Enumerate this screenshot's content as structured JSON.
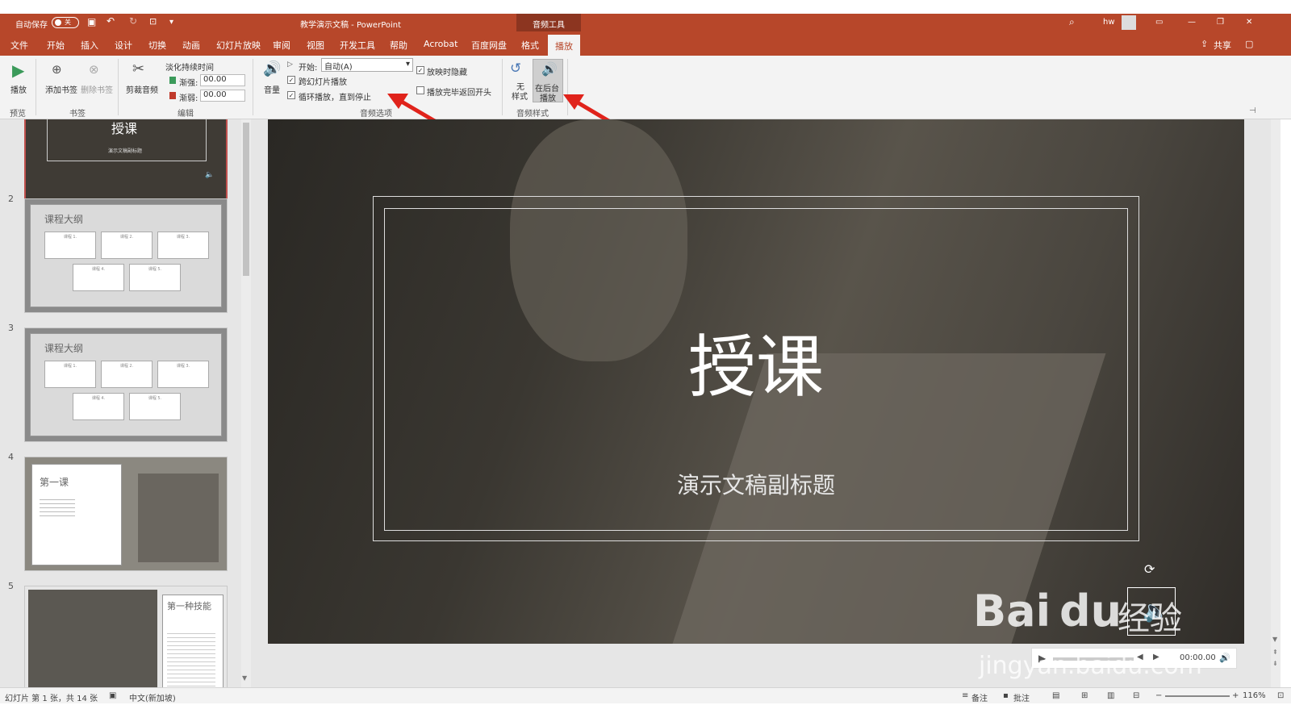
{
  "titlebar": {
    "autosave_label": "自动保存",
    "autosave_state": "关",
    "doc_title": "教学演示文稿 - PowerPoint",
    "context_group": "音频工具",
    "user": "hw"
  },
  "menu": {
    "tabs": [
      "文件",
      "开始",
      "插入",
      "设计",
      "切换",
      "动画",
      "幻灯片放映",
      "审阅",
      "视图",
      "开发工具",
      "帮助",
      "Acrobat",
      "百度网盘",
      "格式"
    ],
    "active_tab": "播放",
    "share": "共享"
  },
  "ribbon": {
    "preview": {
      "play": "播放",
      "group": "预览"
    },
    "bookmarks": {
      "add": "添加书签",
      "remove": "删除书签",
      "group": "书签"
    },
    "editing": {
      "trim": "剪裁音频",
      "fade_title": "淡化持续时间",
      "fade_in_label": "渐强:",
      "fade_in_value": "00.00",
      "fade_out_label": "渐弱:",
      "fade_out_value": "00.00",
      "group": "编辑"
    },
    "audio_options": {
      "volume": "音量",
      "start_label": "开始:",
      "start_value": "自动(A)",
      "across_slides": "跨幻灯片播放",
      "loop": "循环播放，直到停止",
      "hide": "放映时隐藏",
      "rewind": "播放完毕返回开头",
      "group": "音频选项",
      "across_checked": "✓",
      "loop_checked": "✓",
      "hide_checked": "✓"
    },
    "audio_styles": {
      "none_l1": "无",
      "none_l2": "样式",
      "bg_l1": "在后台",
      "bg_l2": "播放",
      "group": "音频样式"
    }
  },
  "slides_pane": {
    "numbers": [
      "2",
      "3",
      "4",
      "5"
    ],
    "thumb1_title": "授课",
    "thumb1_sub": "演示文稿副标题",
    "thumb2_title": "课程大纲",
    "thumb3_title": "课程大纲",
    "cards": [
      "课程 1.",
      "课程 2.",
      "课程 3.",
      "课程 4.",
      "课程 5."
    ],
    "thumb4_title": "第一课",
    "thumb5_title": "第一种技能"
  },
  "slide": {
    "title": "授课",
    "subtitle": "演示文稿副标题"
  },
  "player": {
    "time": "00:00.00"
  },
  "watermark": {
    "brand": "Bai",
    "brand2": "du",
    "cn": "经验",
    "url": "jingyan.baidu.com"
  },
  "statusbar": {
    "slide_info": "幻灯片 第 1 张，共 14 张",
    "language": "中文(新加坡)",
    "notes": "备注",
    "comments": "批注",
    "zoom": "116%"
  },
  "colors": {
    "accent": "#b7472a",
    "arrow": "#e0231b"
  }
}
